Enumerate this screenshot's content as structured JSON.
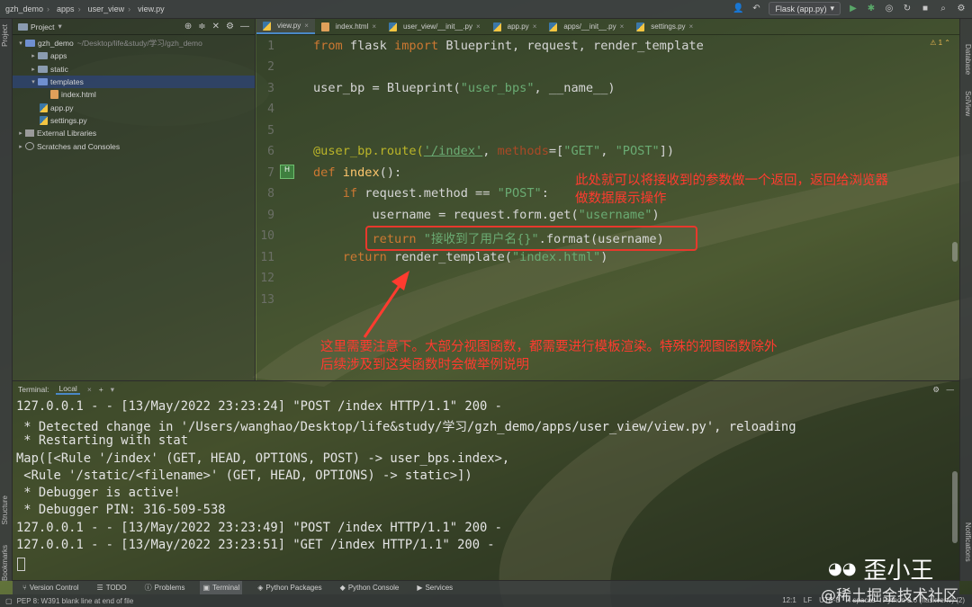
{
  "navbar": {
    "breadcrumbs": [
      "gzh_demo",
      "apps",
      "user_view",
      "view.py"
    ],
    "run_config": "Flask (app.py)"
  },
  "left_strip": {
    "project": "Project",
    "structure": "Structure",
    "bookmarks": "Bookmarks"
  },
  "right_strip": {
    "database": "Database",
    "sciview": "SciView",
    "notifications": "Notifications"
  },
  "project_panel": {
    "title": "Project",
    "tree": [
      {
        "label": "gzh_demo",
        "hint": "~/Desktop/life&study/学习/gzh_demo",
        "type": "folder-open",
        "level": 0
      },
      {
        "label": "apps",
        "type": "folder",
        "level": 1
      },
      {
        "label": "static",
        "type": "folder",
        "level": 1
      },
      {
        "label": "templates",
        "type": "folder-open",
        "level": 1,
        "selected": true
      },
      {
        "label": "index.html",
        "type": "html",
        "level": 2
      },
      {
        "label": "app.py",
        "type": "py",
        "level": 1
      },
      {
        "label": "settings.py",
        "type": "py",
        "level": 1
      },
      {
        "label": "External Libraries",
        "type": "lib",
        "level": 0
      },
      {
        "label": "Scratches and Consoles",
        "type": "scratch",
        "level": 0
      }
    ]
  },
  "editor": {
    "tabs": [
      "view.py",
      "index.html",
      "user_view/__init__.py",
      "app.py",
      "apps/__init__.py",
      "settings.py"
    ],
    "warning": "1",
    "line_numbers": [
      "1",
      "2",
      "3",
      "4",
      "5",
      "6",
      "7",
      "8",
      "9",
      "10",
      "11",
      "12",
      "13"
    ],
    "code": {
      "l1": {
        "kw1": "from",
        "mod": " flask ",
        "kw2": "import",
        "rest": " Blueprint, request, render_template"
      },
      "l3": {
        "a": "user_bp = Blueprint(",
        "s": "\"user_bps\"",
        "b": ", __name__)"
      },
      "l6": {
        "deco": "@user_bp.route(",
        "path": "'/index'",
        "c1": ", ",
        "param": "methods",
        "c2": "=[",
        "s1": "\"GET\"",
        "c3": ", ",
        "s2": "\"POST\"",
        "c4": "])"
      },
      "l7": {
        "kw": "def ",
        "fn": "index",
        "rest": "():"
      },
      "l8": {
        "kw": "    if ",
        "a": "request.method == ",
        "s": "\"POST\"",
        "b": ":"
      },
      "l9": {
        "a": "        username = request.form.get(",
        "s": "\"username\"",
        "b": ")"
      },
      "l10": {
        "kw": "        return ",
        "s": "\"接收到了用户名{}\"",
        "b": ".format(username)"
      },
      "l11": {
        "kw": "    return ",
        "a": "render_template(",
        "s": "\"index.html\"",
        "b": ")"
      }
    },
    "annotation_top": [
      "此处就可以将接收到的参数做一个返回，返回给浏览器",
      "做数据展示操作"
    ],
    "annotation_bottom": [
      "这里需要注意下。大部分视图函数，都需要进行模板渲染。特殊的视图函数除外",
      "后续涉及到这类函数时会做举例说明"
    ]
  },
  "terminal": {
    "label": "Terminal:",
    "tab": "Local",
    "lines": [
      "127.0.0.1 - - [13/May/2022 23:23:24] \"POST /index HTTP/1.1\" 200 -",
      " * Detected change in '/Users/wanghao/Desktop/life&study/学习/gzh_demo/apps/user_view/view.py', reloading",
      " * Restarting with stat",
      "Map([<Rule '/index' (GET, HEAD, OPTIONS, POST) -> user_bps.index>,",
      " <Rule '/static/<filename>' (GET, HEAD, OPTIONS) -> static>])",
      " * Debugger is active!",
      " * Debugger PIN: 316-509-538",
      "127.0.0.1 - - [13/May/2022 23:23:49] \"POST /index HTTP/1.1\" 200 -",
      "127.0.0.1 - - [13/May/2022 23:23:51] \"GET /index HTTP/1.1\" 200 -"
    ]
  },
  "tool_bar": [
    "Version Control",
    "TODO",
    "Problems",
    "Terminal",
    "Python Packages",
    "Python Console",
    "Services"
  ],
  "status_bar": {
    "message": "PEP 8: W391 blank line at end of file",
    "position": "12:1",
    "line_sep": "LF",
    "encoding": "UTF-8",
    "indent": "4 spaces",
    "interpreter": "Python 3.6 (flaskvenv) (2)"
  },
  "watermark": {
    "author": "歪小王",
    "site": "@稀土掘金技术社区"
  },
  "colors": {
    "annotation": "#ff3b2f",
    "accent": "#4a88c7"
  }
}
